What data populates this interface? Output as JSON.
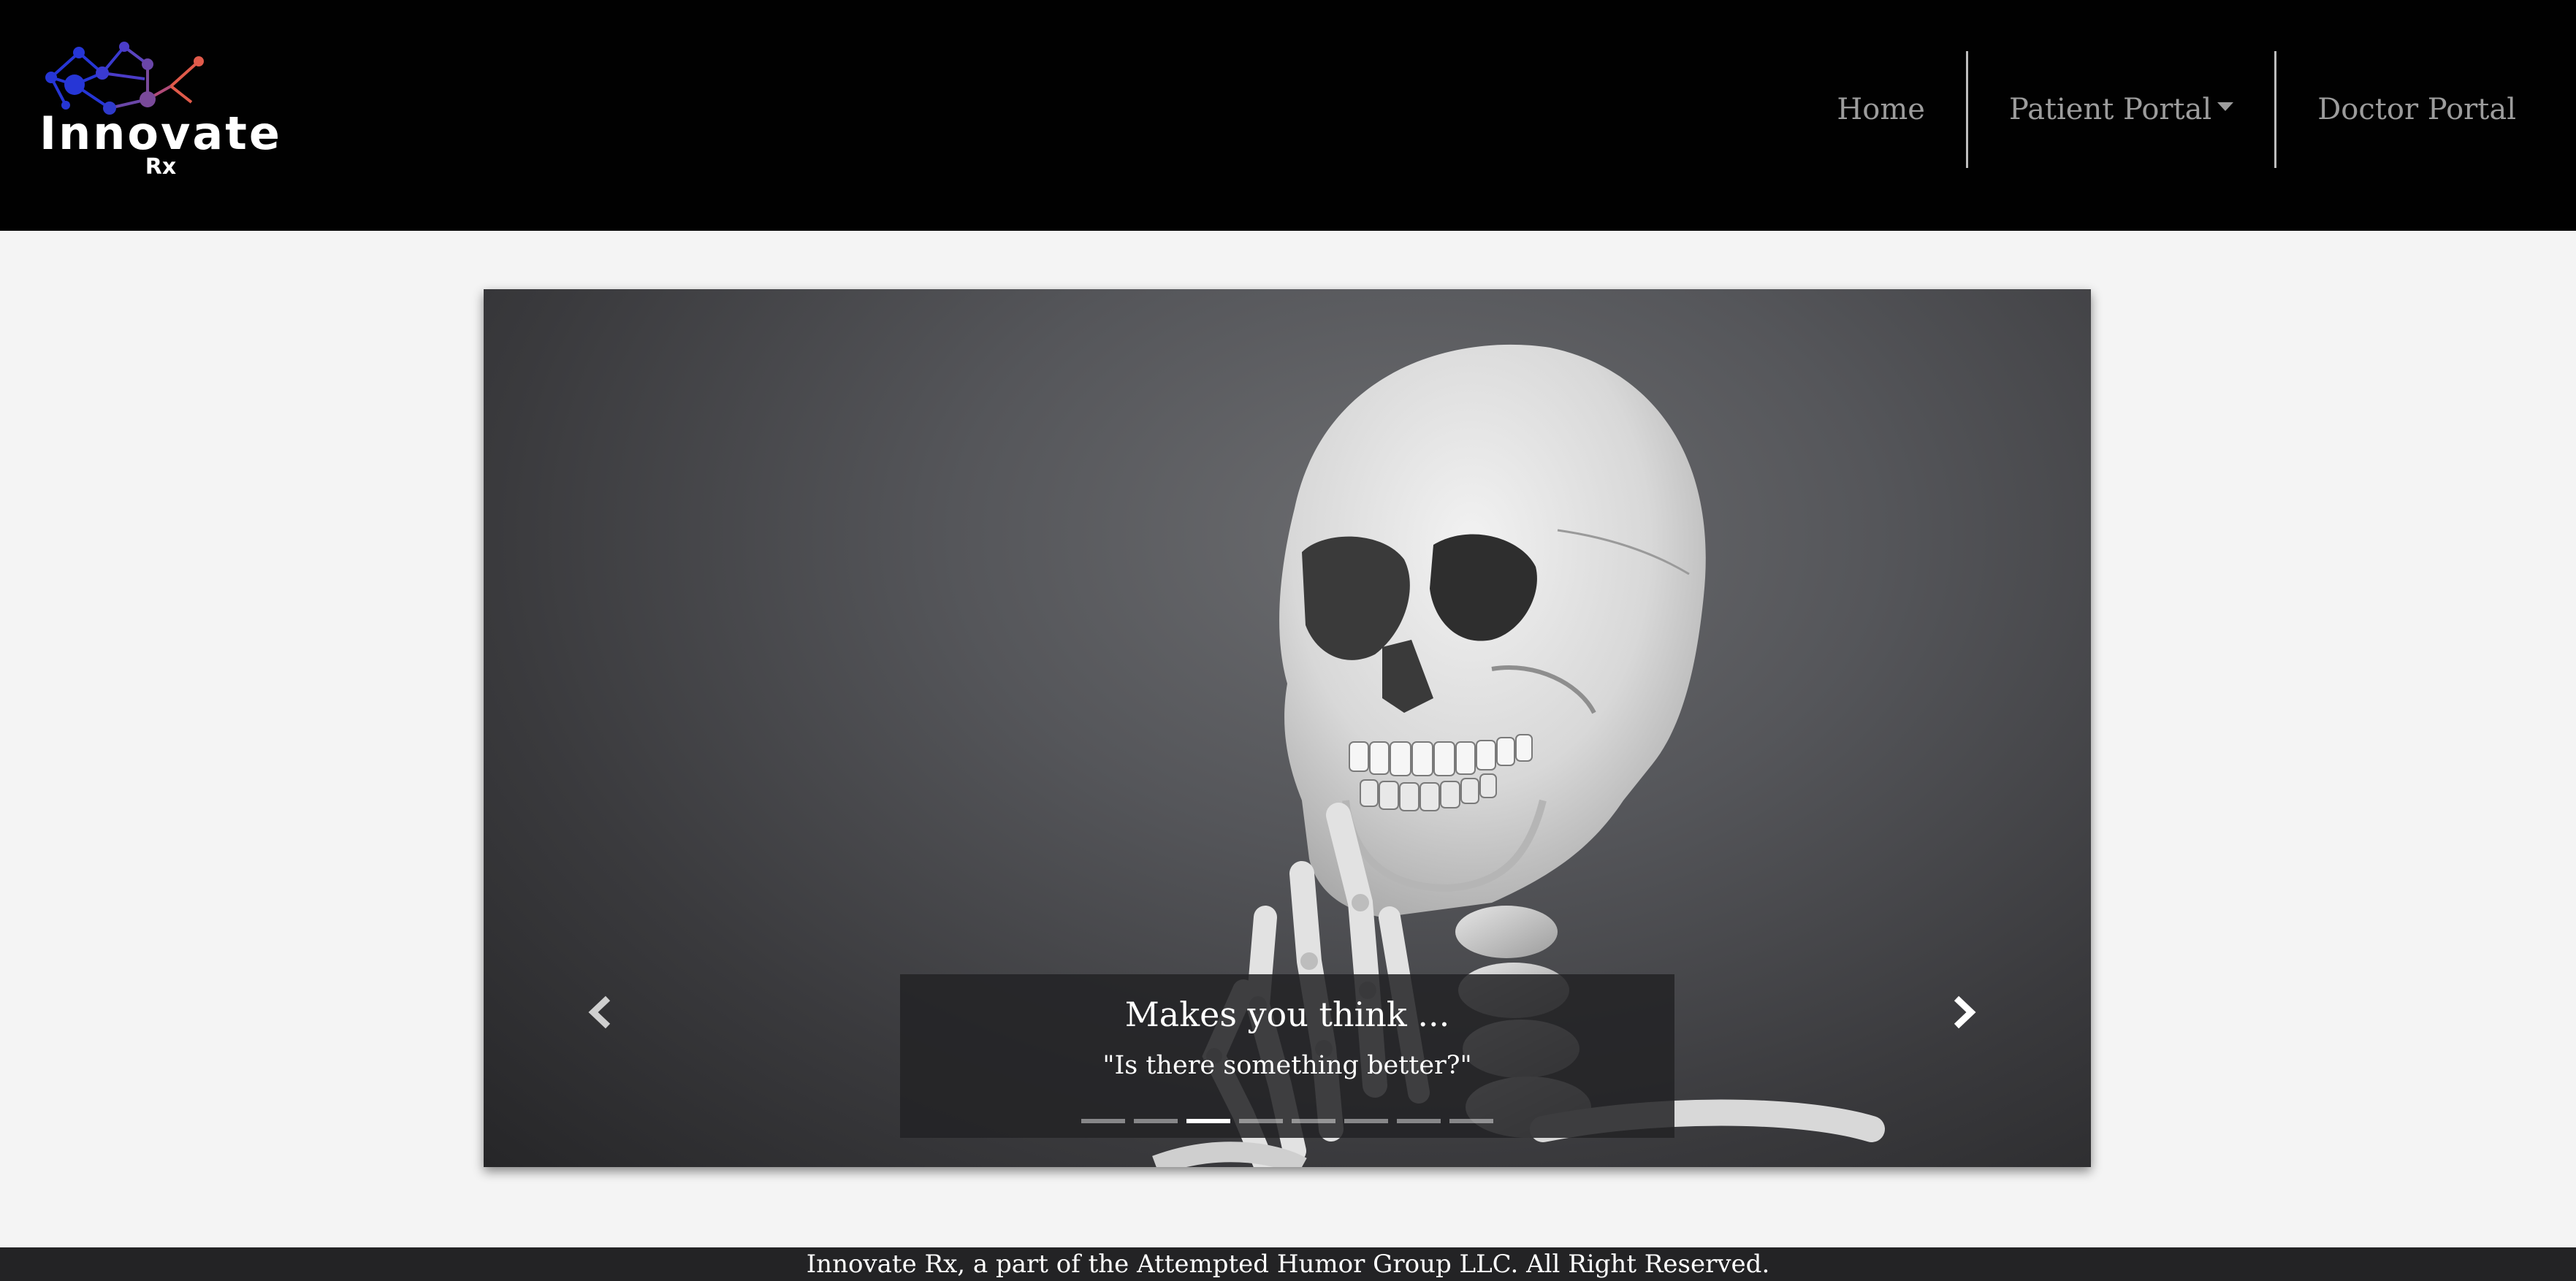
{
  "brand": {
    "name": "Innovate",
    "sub": "Rx"
  },
  "nav": {
    "items": [
      {
        "label": "Home"
      },
      {
        "label": "Patient Portal",
        "has_dropdown": true
      },
      {
        "label": "Doctor Portal"
      }
    ]
  },
  "carousel": {
    "prev_icon": "chevron-left-icon",
    "next_icon": "chevron-right-icon",
    "caption": {
      "title": "Makes you think ...",
      "text": "\"Is there something better?\""
    },
    "indicator_count": 8,
    "active_index": 2
  },
  "footer": {
    "text": "Innovate Rx, a part of the Attempted Humor Group LLC. All Right Reserved."
  },
  "colors": {
    "header_bg": "#010101",
    "page_bg": "#f4f4f4",
    "nav_text": "#9c9c9c",
    "footer_bg": "#232325",
    "logo_blue": "#2636d6",
    "logo_purple": "#7a4a9a",
    "logo_red": "#e05a4a"
  }
}
